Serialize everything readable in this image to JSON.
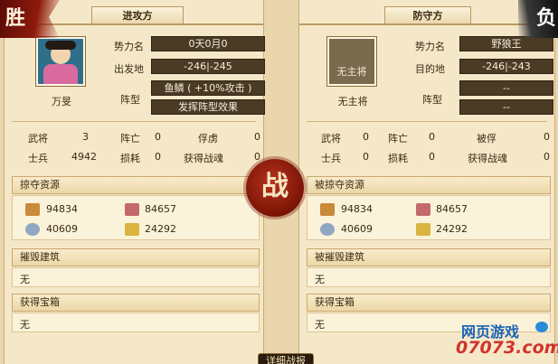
{
  "banners": {
    "win": "胜",
    "lose": "负"
  },
  "battle_seal": "战",
  "attacker": {
    "title": "进攻方",
    "name": "万旻",
    "fields": {
      "faction_label": "势力名",
      "faction_value": "0天0月0",
      "origin_label": "出发地",
      "origin_value": "-246|-245",
      "formation_label": "阵型",
      "formation_value": "鱼鳞 ( +10%攻击 )",
      "formation_action": "发挥阵型效果"
    },
    "stats": {
      "generals_label": "武将",
      "generals_value": "3",
      "dead_label": "阵亡",
      "dead_value": "0",
      "captured_label": "俘虏",
      "captured_value": "0",
      "soldiers_label": "士兵",
      "soldiers_value": "4942",
      "loss_label": "损耗",
      "loss_value": "0",
      "souls_label": "获得战魂",
      "souls_value": "0"
    },
    "resources_title": "掠夺资源",
    "resources": [
      "94834",
      "84657",
      "40609",
      "24292"
    ],
    "buildings_title": "摧毁建筑",
    "buildings_value": "无",
    "chests_title": "获得宝箱",
    "chests_value": "无"
  },
  "defender": {
    "title": "防守方",
    "portrait_caption": "无主将",
    "name": "无主将",
    "fields": {
      "faction_label": "势力名",
      "faction_value": "野狼王",
      "target_label": "目的地",
      "target_value": "-246|-243",
      "formation_label": "阵型",
      "formation_value": "--",
      "formation_value2": "--"
    },
    "stats": {
      "generals_label": "武将",
      "generals_value": "0",
      "dead_label": "阵亡",
      "dead_value": "0",
      "captured_label": "被俘",
      "captured_value": "0",
      "soldiers_label": "士兵",
      "soldiers_value": "0",
      "loss_label": "损耗",
      "loss_value": "0",
      "souls_label": "获得战魂",
      "souls_value": "0"
    },
    "resources_title": "被掠夺资源",
    "resources": [
      "94834",
      "84657",
      "40609",
      "24292"
    ],
    "buildings_title": "被摧毁建筑",
    "buildings_value": "无",
    "chests_title": "获得宝箱",
    "chests_value": "无"
  },
  "detail_button": "详细战报",
  "watermark": {
    "top": "网页游戏",
    "bottom": "07073.com"
  },
  "colors": {
    "panel_bg": "#f5e8c8",
    "value_box": "#4b3a24",
    "seal": "#9b2412",
    "wood_icon": "#c98a3a",
    "stone_icon": "#c46a6a",
    "iron_icon": "#8fa7c0",
    "food_icon": "#d9b441"
  },
  "icons": [
    "wood-icon",
    "stone-icon",
    "iron-icon",
    "grain-icon"
  ]
}
